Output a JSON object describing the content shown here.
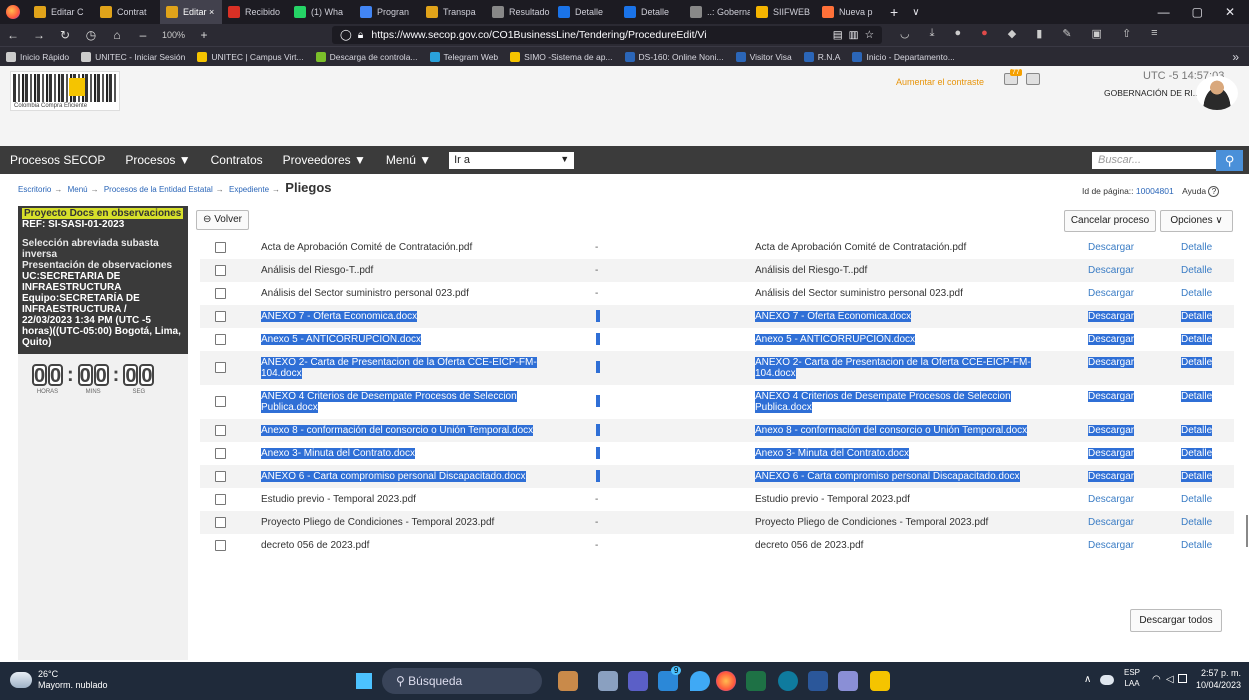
{
  "browser": {
    "tabs": [
      {
        "label": "Editar C",
        "color": "#e0a31a"
      },
      {
        "label": "Contrat",
        "color": "#e0a31a"
      },
      {
        "label": "Editar ×",
        "color": "#e0a31a",
        "active": true
      },
      {
        "label": "Recibido",
        "color": "#d93025"
      },
      {
        "label": "(1) Wha",
        "color": "#25d366"
      },
      {
        "label": "Progran",
        "color": "#4285f4"
      },
      {
        "label": "Transpa",
        "color": "#e0a31a"
      },
      {
        "label": "Resultado d",
        "color": "#888888"
      },
      {
        "label": "Detalle",
        "color": "#1a73e8"
      },
      {
        "label": "Detalle",
        "color": "#1a73e8"
      },
      {
        "label": "..: Gobernac",
        "color": "#888888"
      },
      {
        "label": "SIIFWEB",
        "color": "#f4b400"
      },
      {
        "label": "Nueva p",
        "color": "#ff7139"
      }
    ],
    "zoom": "100%",
    "url": "https://www.secop.gov.co/CO1BusinessLine/Tendering/ProcedureEdit/Vi",
    "bookmarks": [
      {
        "label": "Inicio Rápido",
        "color": "#cccccc"
      },
      {
        "label": "UNITEC - Iniciar Sesión",
        "color": "#cccccc"
      },
      {
        "label": "UNITEC | Campus Virt...",
        "color": "#f5c400"
      },
      {
        "label": "Descarga de controla...",
        "color": "#7bbf2a"
      },
      {
        "label": "Telegram Web",
        "color": "#2aa1da"
      },
      {
        "label": "SIMO -Sistema de ap...",
        "color": "#f5c400"
      },
      {
        "label": "DS-160: Online Noni...",
        "color": "#2b66b8"
      },
      {
        "label": "Visitor Visa",
        "color": "#2b66b8"
      },
      {
        "label": "R.N.A",
        "color": "#2b66b8"
      },
      {
        "label": "Inicio - Departamento...",
        "color": "#2b66b8"
      }
    ]
  },
  "header": {
    "logo_caption": "Colombia Compra Eficiente",
    "contrast_link": "Aumentar el contraste",
    "notif_count": "77",
    "timezone": "UTC -5",
    "time": "14:57:03",
    "entity": "GOBERNACIÓN DE RI..."
  },
  "menu": {
    "items": [
      "Procesos SECOP",
      "Procesos ▼",
      "Contratos",
      "Proveedores ▼",
      "Menú ▼"
    ],
    "goto": "Ir a",
    "search_placeholder": "Buscar..."
  },
  "breadcrumb": {
    "items": [
      "Escritorio",
      "Menú",
      "Procesos de la Entidad Estatal",
      "Expediente"
    ],
    "current": "Pliegos",
    "page_id_label": "Id de página::",
    "page_id": "10004801",
    "help": "Ayuda"
  },
  "process": {
    "status": "Proyecto Docs en observaciones",
    "ref": "REF: SI-SASI-01-2023",
    "type": "Selección abreviada subasta inversa",
    "phase": "Presentación de observaciones",
    "unit": "UC:SECRETARIA DE INFRAESTRUCTURA",
    "team": "Equipo:SECRETARÍA DE INFRAESTRUCTURA /",
    "date": "22/03/2023 1:34 PM (UTC -5 horas)((UTC-05:00) Bogotá, Lima, Quito)",
    "timer": {
      "hours": "00",
      "mins": "00",
      "secs": "00",
      "hours_label": "HORAS",
      "mins_label": "MINS",
      "secs_label": "SEG"
    }
  },
  "buttons": {
    "back": "Volver",
    "cancel": "Cancelar proceso",
    "options": "Opciones ∨",
    "download_all": "Descargar todos"
  },
  "documents": [
    {
      "name": "Acta de Aprobación Comité de Contratación.pdf",
      "dash": "-",
      "name2": "Acta de Aprobación Comité de Contratación.pdf",
      "dl": "Descargar",
      "det": "Detalle",
      "selected": false
    },
    {
      "name": "Análisis del Riesgo-T..pdf",
      "dash": "-",
      "name2": "Análisis del Riesgo-T..pdf",
      "dl": "Descargar",
      "det": "Detalle",
      "selected": false
    },
    {
      "name": "Análisis del Sector suministro personal 023.pdf",
      "dash": "-",
      "name2": "Análisis del Sector suministro personal 023.pdf",
      "dl": "Descargar",
      "det": "Detalle",
      "selected": false
    },
    {
      "name": "ANEXO 7 - Oferta Economica.docx",
      "dash": "",
      "name2": "ANEXO 7 - Oferta Economica.docx",
      "dl": "Descargar",
      "det": "Detalle",
      "selected": true
    },
    {
      "name": "Anexo 5 - ANTICORRUPCION.docx",
      "dash": "",
      "name2": "Anexo 5 - ANTICORRUPCION.docx",
      "dl": "Descargar",
      "det": "Detalle",
      "selected": true
    },
    {
      "name": "ANEXO 2- Carta de Presentacion de la Oferta CCE-EICP-FM-104.docx",
      "dash": "",
      "name2": "ANEXO 2- Carta de Presentacion de la Oferta CCE-EICP-FM-104.docx",
      "dl": "Descargar",
      "det": "Detalle",
      "selected": true,
      "two": true
    },
    {
      "name": "ANEXO 4 Criterios de Desempate Procesos de Seleccion Publica.docx",
      "dash": "",
      "name2": "ANEXO 4 Criterios de Desempate Procesos de Seleccion Publica.docx",
      "dl": "Descargar",
      "det": "Detalle",
      "selected": true,
      "two": true
    },
    {
      "name": "Anexo 8 - conformación del consorcio o Unión Temporal.docx",
      "dash": "",
      "name2": "Anexo 8 - conformación del consorcio o Unión Temporal.docx",
      "dl": "Descargar",
      "det": "Detalle",
      "selected": true
    },
    {
      "name": "Anexo 3- Minuta del Contrato.docx",
      "dash": "",
      "name2": "Anexo 3- Minuta del Contrato.docx",
      "dl": "Descargar",
      "det": "Detalle",
      "selected": true
    },
    {
      "name": "ANEXO 6 - Carta compromiso personal Discapacitado.docx",
      "dash": "",
      "name2": "ANEXO 6 - Carta compromiso personal Discapacitado.docx",
      "dl": "Descargar",
      "det": "Detalle",
      "selected": true
    },
    {
      "name": "Estudio previo - Temporal 2023.pdf",
      "dash": "-",
      "name2": "Estudio previo - Temporal 2023.pdf",
      "dl": "Descargar",
      "det": "Detalle",
      "selected": false
    },
    {
      "name": "Proyecto Pliego de Condiciones - Temporal 2023.pdf",
      "dash": "-",
      "name2": "Proyecto Pliego de Condiciones - Temporal 2023.pdf",
      "dl": "Descargar",
      "det": "Detalle",
      "selected": false
    },
    {
      "name": "decreto 056 de 2023.pdf",
      "dash": "-",
      "name2": "decreto 056 de 2023.pdf",
      "dl": "Descargar",
      "det": "Detalle",
      "selected": false
    }
  ],
  "taskbar": {
    "temp": "26°C",
    "weather": "Mayorm. nublado",
    "search": "Búsqueda",
    "lang1": "ESP",
    "lang2": "LAA",
    "time": "2:57 p. m.",
    "date": "10/04/2023",
    "mail_badge": "9"
  },
  "colors": {
    "accent": "#2b66b8",
    "selection": "#2f6fd6",
    "menu_bg": "#3b3b3b"
  }
}
